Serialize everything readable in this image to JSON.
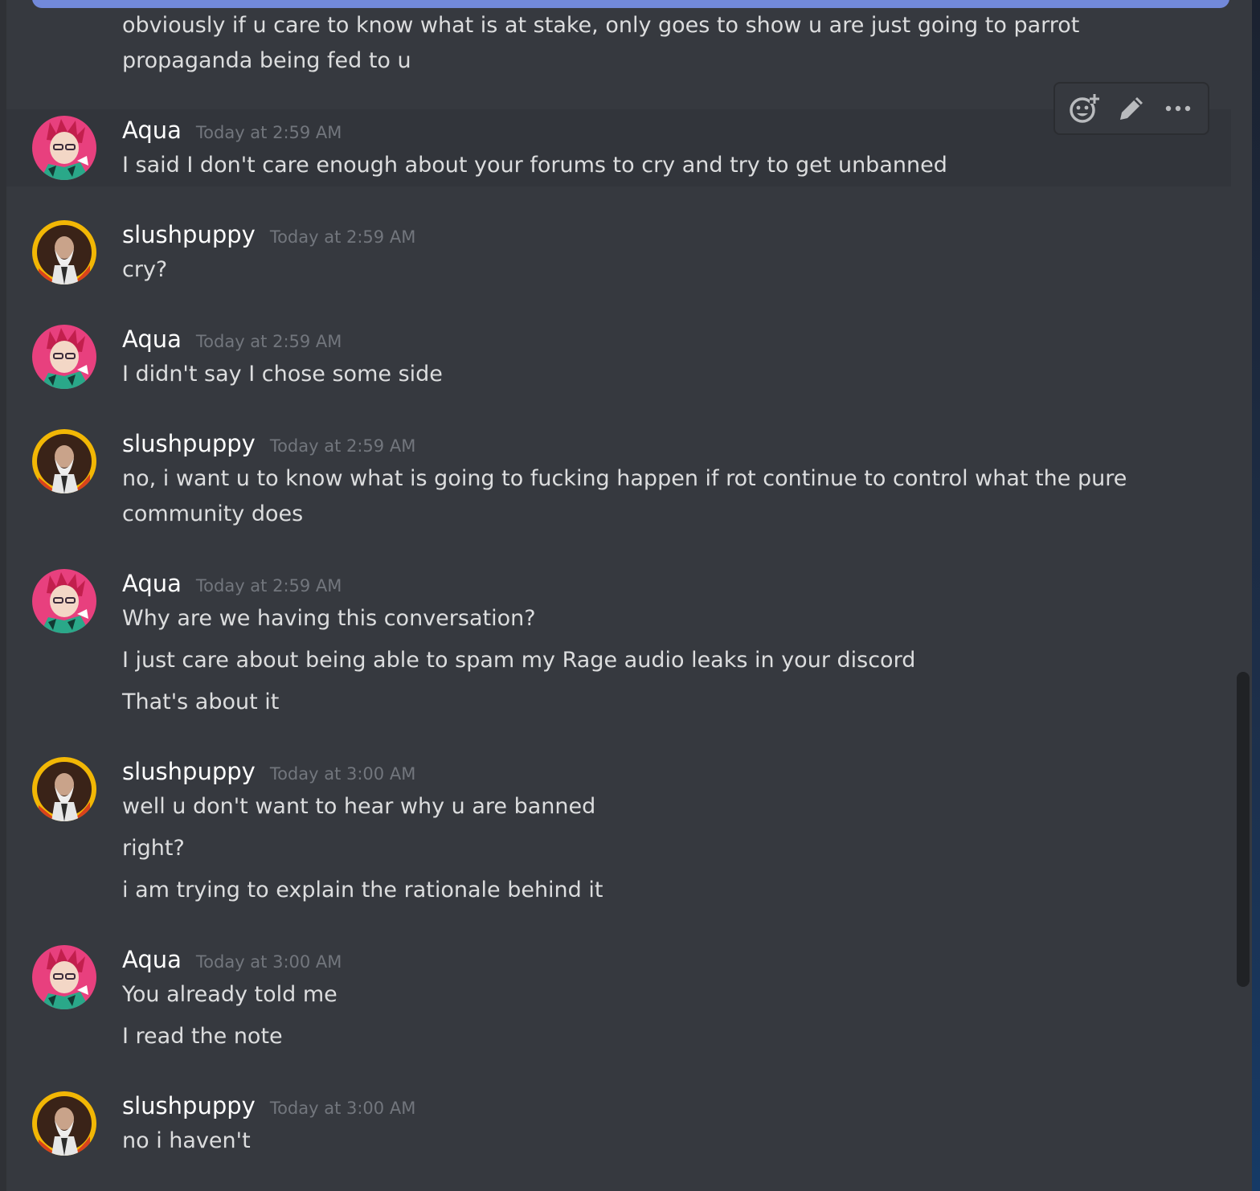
{
  "top_message": {
    "lines": [
      "obviously if u care to know what is at stake, only goes to show u are just going to parrot",
      "propaganda being fed to u"
    ]
  },
  "hover_toolbar": {
    "icons": [
      "add-reaction-icon",
      "edit-pencil-icon",
      "more-options-icon"
    ]
  },
  "messages": [
    {
      "author": "Aqua",
      "timestamp": "Today at 2:59 AM",
      "lines": [
        "I said I don't care enough about your forums to cry and try to get unbanned"
      ]
    },
    {
      "author": "slushpuppy",
      "timestamp": "Today at 2:59 AM",
      "lines": [
        "cry?"
      ]
    },
    {
      "author": "Aqua",
      "timestamp": "Today at 2:59 AM",
      "lines": [
        "I didn't say I chose some side"
      ]
    },
    {
      "author": "slushpuppy",
      "timestamp": "Today at 2:59 AM",
      "lines": [
        "no, i want u to know what is going to fucking happen if rot continue to control what the pure",
        "community does"
      ]
    },
    {
      "author": "Aqua",
      "timestamp": "Today at 2:59 AM",
      "lines": [
        "Why are we having this conversation?",
        "I just care about being able to spam my Rage audio leaks in your discord",
        "That's about it"
      ]
    },
    {
      "author": "slushpuppy",
      "timestamp": "Today at 3:00 AM",
      "lines": [
        "well u don't want to hear why u are banned",
        "right?",
        "i am trying to explain the rationale behind it"
      ]
    },
    {
      "author": "Aqua",
      "timestamp": "Today at 3:00 AM",
      "lines": [
        "You already told me",
        "I read the note"
      ]
    },
    {
      "author": "slushpuppy",
      "timestamp": "Today at 3:00 AM",
      "lines": [
        "no i haven't"
      ]
    }
  ],
  "colors": {
    "background": "#36393f",
    "username": "#ffffff",
    "timestamp": "#72767d",
    "message_text": "#dcddde",
    "top_bar": "#7289da",
    "aqua_avatar_bg": "#e8407e",
    "slushpuppy_avatar_bg": "#f2b705"
  }
}
